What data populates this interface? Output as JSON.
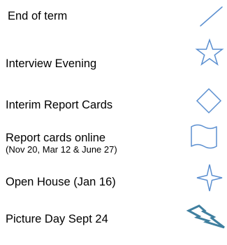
{
  "legend": {
    "items": [
      {
        "label": "End of term",
        "sublabel": "",
        "icon": "diagonal-line-icon"
      },
      {
        "label": "Interview Evening",
        "sublabel": "",
        "icon": "five-point-star-icon"
      },
      {
        "label": "Interim Report Cards",
        "sublabel": "",
        "icon": "diamond-icon"
      },
      {
        "label": "Report cards online",
        "sublabel": "(Nov 20, Mar 12 & June 27)",
        "icon": "flag-wave-icon"
      },
      {
        "label": "Open House (Jan 16)",
        "sublabel": "",
        "icon": "four-point-star-icon"
      },
      {
        "label": "Picture Day Sept 24",
        "sublabel": "",
        "icon": "lightning-bolt-icon"
      }
    ],
    "colors": {
      "icon_stroke": "#5b8fd0",
      "text": "#000000"
    }
  }
}
